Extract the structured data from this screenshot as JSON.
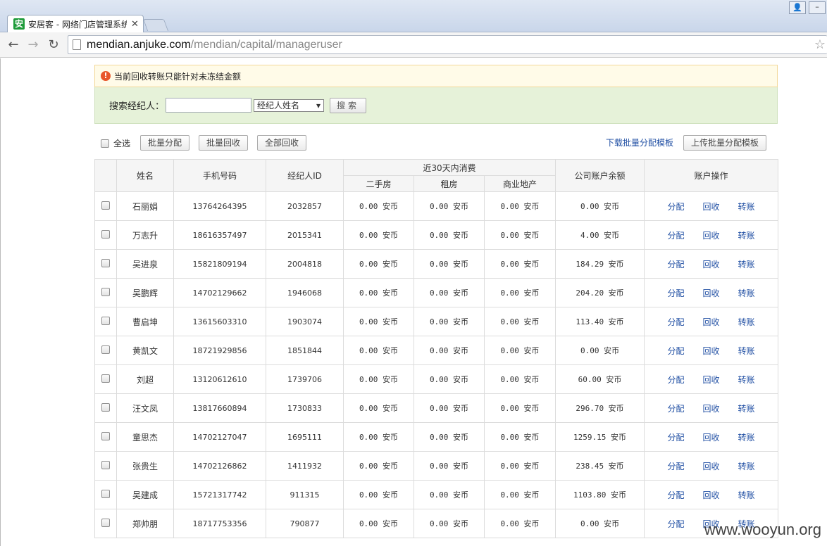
{
  "browser": {
    "tab_title": "安居客 - 网络门店管理系统",
    "favicon_text": "安",
    "url_host": "mendian.anjuke.com",
    "url_path": "/mendian/capital/manageruser"
  },
  "notice": {
    "text": "当前回收转账只能针对未冻结金额"
  },
  "search": {
    "label": "搜索经纪人：",
    "input_value": "",
    "select_value": "经纪人姓名",
    "button_label": "搜索"
  },
  "actions": {
    "select_all": "全选",
    "batch_assign": "批量分配",
    "batch_reclaim": "批量回收",
    "reclaim_all": "全部回收",
    "download_template": "下载批量分配模板",
    "upload_template": "上传批量分配模板"
  },
  "table": {
    "headers": {
      "name": "姓名",
      "phone": "手机号码",
      "agent_id": "经纪人ID",
      "consume_30d": "近30天内消费",
      "second_hand": "二手房",
      "rent": "租房",
      "commercial": "商业地产",
      "balance": "公司账户余额",
      "operations": "账户操作"
    },
    "op_labels": {
      "assign": "分配",
      "reclaim": "回收",
      "transfer": "转账"
    },
    "rows": [
      {
        "name": "石丽娟",
        "phone": "13764264395",
        "id": "2032857",
        "second": "0.00 安币",
        "rent": "0.00 安币",
        "commercial": "0.00 安币",
        "balance": "0.00 安币"
      },
      {
        "name": "万志升",
        "phone": "18616357497",
        "id": "2015341",
        "second": "0.00 安币",
        "rent": "0.00 安币",
        "commercial": "0.00 安币",
        "balance": "4.00 安币"
      },
      {
        "name": "吴进泉",
        "phone": "15821809194",
        "id": "2004818",
        "second": "0.00 安币",
        "rent": "0.00 安币",
        "commercial": "0.00 安币",
        "balance": "184.29 安币"
      },
      {
        "name": "吴鹏辉",
        "phone": "14702129662",
        "id": "1946068",
        "second": "0.00 安币",
        "rent": "0.00 安币",
        "commercial": "0.00 安币",
        "balance": "204.20 安币"
      },
      {
        "name": "曹启坤",
        "phone": "13615603310",
        "id": "1903074",
        "second": "0.00 安币",
        "rent": "0.00 安币",
        "commercial": "0.00 安币",
        "balance": "113.40 安币"
      },
      {
        "name": "黄凯文",
        "phone": "18721929856",
        "id": "1851844",
        "second": "0.00 安币",
        "rent": "0.00 安币",
        "commercial": "0.00 安币",
        "balance": "0.00 安币"
      },
      {
        "name": "刘超",
        "phone": "13120612610",
        "id": "1739706",
        "second": "0.00 安币",
        "rent": "0.00 安币",
        "commercial": "0.00 安币",
        "balance": "60.00 安币"
      },
      {
        "name": "汪文凤",
        "phone": "13817660894",
        "id": "1730833",
        "second": "0.00 安币",
        "rent": "0.00 安币",
        "commercial": "0.00 安币",
        "balance": "296.70 安币"
      },
      {
        "name": "童思杰",
        "phone": "14702127047",
        "id": "1695111",
        "second": "0.00 安币",
        "rent": "0.00 安币",
        "commercial": "0.00 安币",
        "balance": "1259.15 安币"
      },
      {
        "name": "张贵生",
        "phone": "14702126862",
        "id": "1411932",
        "second": "0.00 安币",
        "rent": "0.00 安币",
        "commercial": "0.00 安币",
        "balance": "238.45 安币"
      },
      {
        "name": "吴建成",
        "phone": "15721317742",
        "id": "911315",
        "second": "0.00 安币",
        "rent": "0.00 安币",
        "commercial": "0.00 安币",
        "balance": "1103.80 安币"
      },
      {
        "name": "郑帅朋",
        "phone": "18717753356",
        "id": "790877",
        "second": "0.00 安币",
        "rent": "0.00 安币",
        "commercial": "0.00 安币",
        "balance": "0.00 安币"
      }
    ]
  },
  "watermark": "www.wooyun.org",
  "colors": {
    "link": "#1f4ea3",
    "notice_bg": "#fffbe8",
    "search_bg": "#e6f2d9",
    "warn": "#e8562a"
  }
}
